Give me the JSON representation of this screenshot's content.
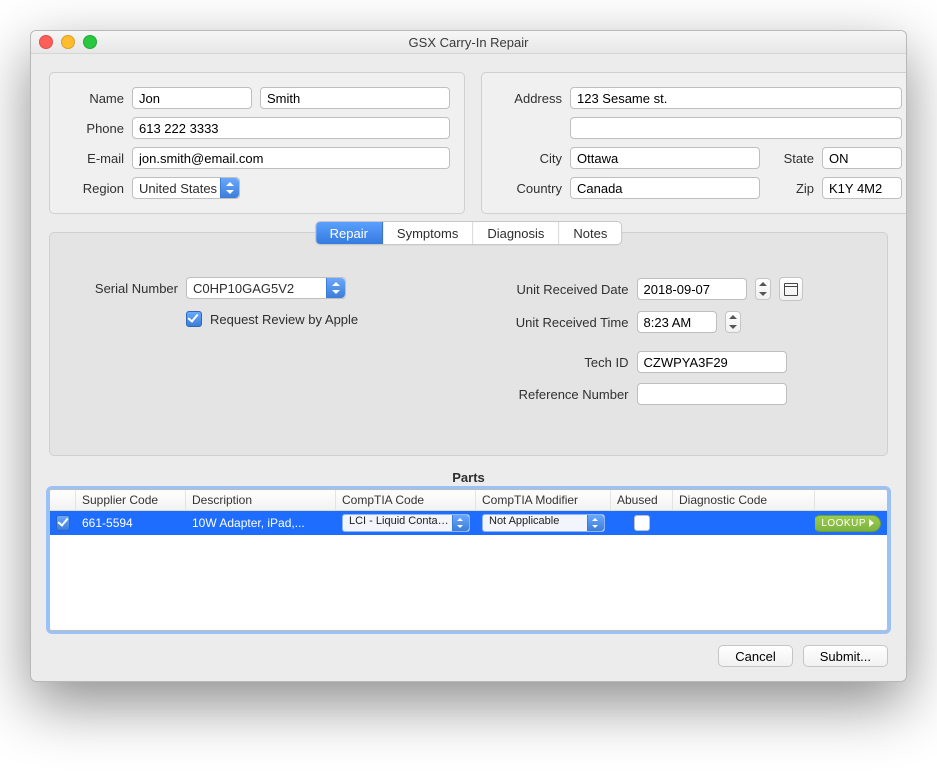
{
  "window": {
    "title": "GSX Carry-In Repair"
  },
  "customer": {
    "labels": {
      "name": "Name",
      "phone": "Phone",
      "email": "E-mail",
      "region": "Region"
    },
    "first_name": "Jon",
    "last_name": "Smith",
    "phone": "613 222 3333",
    "email": "jon.smith@email.com",
    "region": "United States"
  },
  "address": {
    "labels": {
      "address": "Address",
      "city": "City",
      "state": "State",
      "country": "Country",
      "zip": "Zip"
    },
    "line1": "123 Sesame st.",
    "line2": "",
    "city": "Ottawa",
    "state": "ON",
    "country": "Canada",
    "zip": "K1Y 4M2"
  },
  "tabs": {
    "repair": "Repair",
    "symptoms": "Symptoms",
    "diagnosis": "Diagnosis",
    "notes": "Notes"
  },
  "repair": {
    "labels": {
      "serial_number": "Serial Number",
      "request_review": "Request Review by Apple",
      "unit_received_date": "Unit Received Date",
      "unit_received_time": "Unit Received Time",
      "tech_id": "Tech ID",
      "reference_number": "Reference Number"
    },
    "serial_number": "C0HP10GAG5V2",
    "request_review_checked": true,
    "unit_received_date": "2018-09-07",
    "unit_received_time": "8:23 AM",
    "tech_id": "CZWPYA3F29",
    "reference_number": ""
  },
  "parts": {
    "title": "Parts",
    "columns": {
      "check": "",
      "supplier_code": "Supplier Code",
      "description": "Description",
      "comptia_code": "CompTIA Code",
      "comptia_modifier": "CompTIA Modifier",
      "abused": "Abused",
      "diagnostic_code": "Diagnostic Code",
      "lookup": ""
    },
    "rows": [
      {
        "checked": true,
        "supplier_code": "661-5594",
        "description": "10W Adapter, iPad,...",
        "comptia_code": "LCI - Liquid Contami...",
        "comptia_modifier": "Not Applicable",
        "abused": false,
        "diagnostic_code": "",
        "lookup": "LOOKUP"
      }
    ]
  },
  "footer": {
    "cancel": "Cancel",
    "submit": "Submit..."
  }
}
